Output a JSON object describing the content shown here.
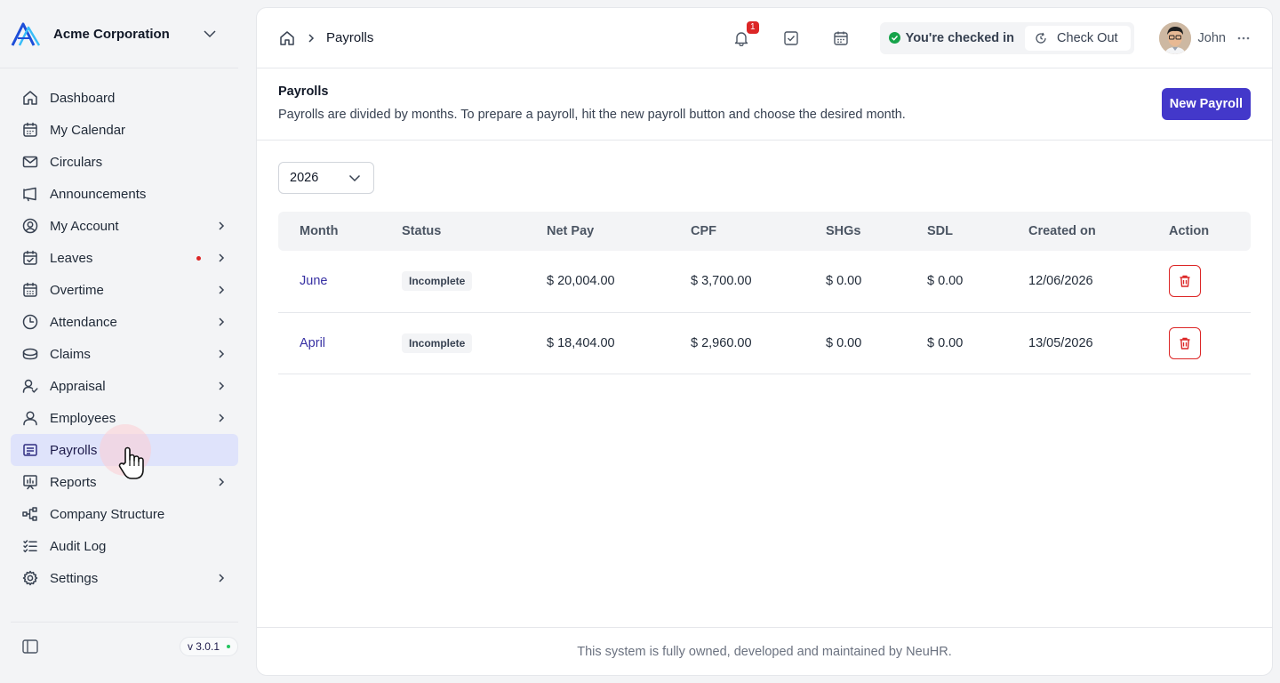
{
  "brand": {
    "name": "Acme Corporation"
  },
  "sidebar": {
    "items": [
      {
        "label": "Dashboard",
        "icon": "home-icon",
        "chevron": false,
        "dot": false,
        "active": false
      },
      {
        "label": "My Calendar",
        "icon": "calendar-icon",
        "chevron": false,
        "dot": false,
        "active": false
      },
      {
        "label": "Circulars",
        "icon": "mail-icon",
        "chevron": false,
        "dot": false,
        "active": false
      },
      {
        "label": "Announcements",
        "icon": "megaphone-icon",
        "chevron": false,
        "dot": false,
        "active": false
      },
      {
        "label": "My Account",
        "icon": "user-circle-icon",
        "chevron": true,
        "dot": false,
        "active": false
      },
      {
        "label": "Leaves",
        "icon": "calendar-check-icon",
        "chevron": true,
        "dot": true,
        "active": false
      },
      {
        "label": "Overtime",
        "icon": "calendar-grid-icon",
        "chevron": true,
        "dot": false,
        "active": false
      },
      {
        "label": "Attendance",
        "icon": "clock-icon",
        "chevron": true,
        "dot": false,
        "active": false
      },
      {
        "label": "Claims",
        "icon": "coins-icon",
        "chevron": true,
        "dot": false,
        "active": false
      },
      {
        "label": "Appraisal",
        "icon": "user-check-icon",
        "chevron": true,
        "dot": false,
        "active": false
      },
      {
        "label": "Employees",
        "icon": "user-icon",
        "chevron": true,
        "dot": false,
        "active": false
      },
      {
        "label": "Payrolls",
        "icon": "receipt-icon",
        "chevron": false,
        "dot": false,
        "active": true
      },
      {
        "label": "Reports",
        "icon": "report-icon",
        "chevron": true,
        "dot": false,
        "active": false
      },
      {
        "label": "Company Structure",
        "icon": "hierarchy-icon",
        "chevron": false,
        "dot": false,
        "active": false
      },
      {
        "label": "Audit Log",
        "icon": "checklist-icon",
        "chevron": false,
        "dot": false,
        "active": false
      },
      {
        "label": "Settings",
        "icon": "gear-icon",
        "chevron": true,
        "dot": false,
        "active": false
      }
    ],
    "version": "v 3.0.1"
  },
  "header": {
    "breadcrumb": "Payrolls",
    "notification_count": "1",
    "checkin_status": "You're checked in",
    "checkout_label": "Check Out",
    "user_name": "John"
  },
  "page": {
    "title": "Payrolls",
    "description": "Payrolls are divided by months. To prepare a payroll, hit the new payroll button and choose the desired month.",
    "new_button": "New Payroll",
    "year": "2026"
  },
  "table": {
    "columns": [
      "Month",
      "Status",
      "Net Pay",
      "CPF",
      "SHGs",
      "SDL",
      "Created on",
      "Action"
    ],
    "rows": [
      {
        "month": "June",
        "status": "Incomplete",
        "net_pay": "$ 20,004.00",
        "cpf": "$ 3,700.00",
        "shgs": "$ 0.00",
        "sdl": "$ 0.00",
        "created_on": "12/06/2026"
      },
      {
        "month": "April",
        "status": "Incomplete",
        "net_pay": "$ 18,404.00",
        "cpf": "$ 2,960.00",
        "shgs": "$ 0.00",
        "sdl": "$ 0.00",
        "created_on": "13/05/2026"
      }
    ]
  },
  "footer": {
    "text": "This system is fully owned, developed and maintained by NeuHR."
  },
  "colors": {
    "accent": "#4338ca",
    "active_nav": "#dfe3fb",
    "danger": "#dc2626",
    "success": "#16a34a"
  }
}
